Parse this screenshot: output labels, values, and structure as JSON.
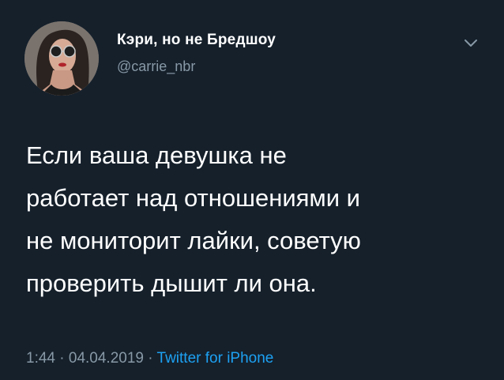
{
  "author": {
    "display_name": "Кэри, но не Бредшоу",
    "handle": "@carrie_nbr"
  },
  "tweet": {
    "lines": [
      "Если ваша девушка не",
      "работает над отношениями и",
      "не мониторит лайки, советую",
      "проверить дышит ли она."
    ]
  },
  "meta": {
    "time": "1:44",
    "separator": "·",
    "date": "04.04.2019",
    "source": "Twitter for iPhone"
  },
  "icons": {
    "menu": "chevron-down-icon"
  },
  "colors": {
    "background": "#15202b",
    "text": "#ffffff",
    "secondary": "#8899a6",
    "accent": "#1da1f2"
  }
}
